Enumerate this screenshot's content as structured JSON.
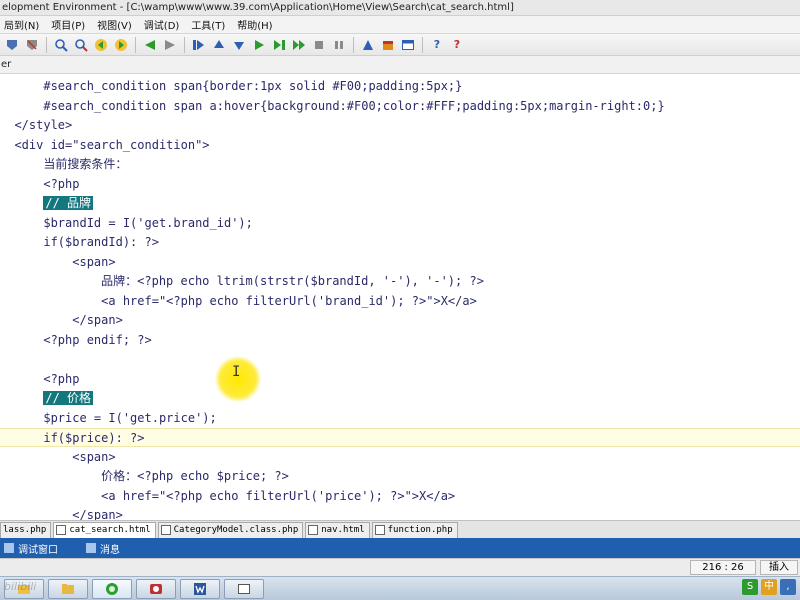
{
  "window": {
    "title": "elopment Environment - [C:\\wamp\\www\\www.39.com\\Application\\Home\\View\\Search\\cat_search.html]"
  },
  "menu": [
    "局到(N)",
    "项目(P)",
    "视图(V)",
    "调试(D)",
    "工具(T)",
    "帮助(H)"
  ],
  "toolbar": {
    "icons": [
      "bookmark-icon",
      "bookmark-clear-icon",
      "find-icon",
      "find-next-icon",
      "back-icon",
      "forward-icon",
      "prev-icon",
      "next-icon",
      "step-in-icon",
      "up-icon",
      "down-icon",
      "run-icon",
      "step-icon",
      "run-to-icon",
      "stop-icon",
      "pause-icon",
      "tools-icon",
      "package-icon",
      "layout-icon",
      "help-icon",
      "context-help-icon"
    ],
    "colors": {
      "green": "#2c9a2c",
      "blue": "#2f5fb5",
      "gray": "#8a8a8a",
      "red": "#c03030"
    }
  },
  "subbar_text": "er",
  "editor": {
    "lines": [
      "      #search_condition span{border:1px solid #F00;padding:5px;}",
      "      #search_condition span a:hover{background:#F00;color:#FFF;padding:5px;margin-right:0;}",
      "  </style>",
      "  <div id=\"search_condition\">",
      "      当前搜索条件：",
      "      <?php",
      "      // 品牌",
      "      $brandId = I('get.brand_id');",
      "      if($brandId): ?>",
      "          <span>",
      "              品牌：<?php echo ltrim(strstr($brandId, '-'), '-'); ?>",
      "              <a href=\"<?php echo filterUrl('brand_id'); ?>\">X</a>",
      "          </span>",
      "      <?php endif; ?>",
      "",
      "      <?php",
      "      // 价格",
      "      $price = I('get.price');",
      "      if($price): ?>",
      "          <span>",
      "              价格：<?php echo $price; ?>",
      "              <a href=\"<?php echo filterUrl('price'); ?>\">X</a>",
      "          </span>"
    ],
    "comment_lines": [
      6,
      16
    ],
    "current_line": 18,
    "highlight_color": "#13787e"
  },
  "file_tabs": [
    "lass.php",
    "cat_search.html",
    "CategoryModel.class.php",
    "nav.html",
    "function.php"
  ],
  "active_tab": 1,
  "panel_tabs": [
    "调试窗口",
    "消息"
  ],
  "status": {
    "position": "216 : 26",
    "mode": "插入"
  },
  "taskbar": {
    "items": [
      "explorer-icon",
      "folder-icon",
      "browser-icon",
      "recorder-icon",
      "word-icon",
      "window-icon"
    ],
    "watermark": "bilibili"
  }
}
